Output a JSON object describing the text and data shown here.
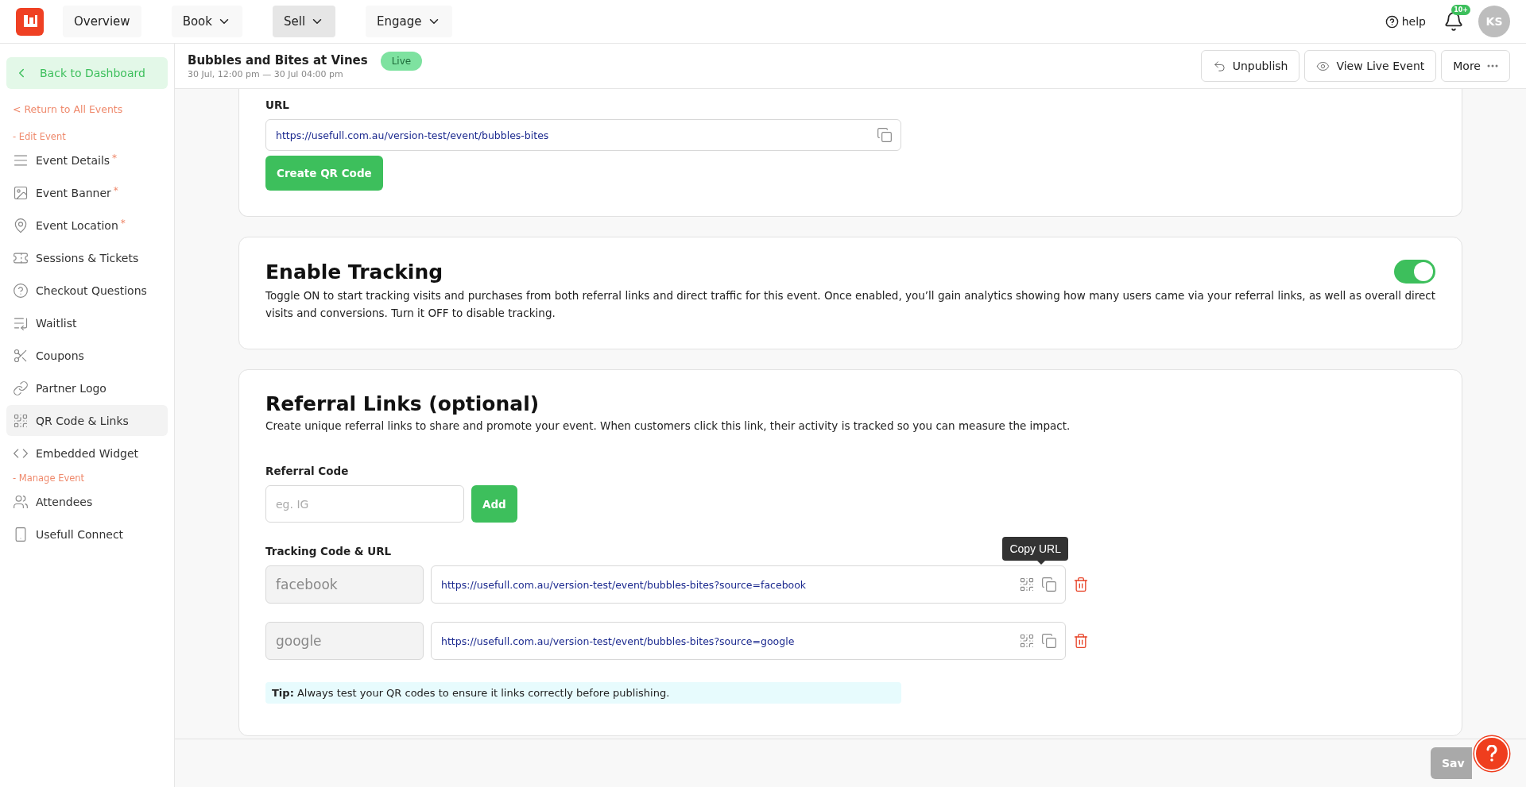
{
  "top_nav": {
    "items": [
      {
        "label": "Overview",
        "dropdown": false,
        "selected": false
      },
      {
        "label": "Book",
        "dropdown": true,
        "selected": false
      },
      {
        "label": "Sell",
        "dropdown": true,
        "selected": true
      },
      {
        "label": "Engage",
        "dropdown": true,
        "selected": false
      }
    ],
    "help": "help",
    "notification_badge": "10+",
    "avatar": "KS"
  },
  "sidebar": {
    "back": "Back to Dashboard",
    "required_mark": "*",
    "return_link": "< Return to All Events",
    "sections": [
      {
        "title": "- Edit Event",
        "items": [
          {
            "label": "Event Details",
            "required": true,
            "selected": false
          },
          {
            "label": "Event Banner",
            "required": true,
            "selected": false
          },
          {
            "label": "Event Location",
            "required": true,
            "selected": false
          },
          {
            "label": "Sessions & Tickets",
            "required": false,
            "selected": false
          },
          {
            "label": "Checkout Questions",
            "required": false,
            "selected": false
          },
          {
            "label": "Waitlist",
            "required": false,
            "selected": false
          },
          {
            "label": "Coupons",
            "required": false,
            "selected": false
          },
          {
            "label": "Partner Logo",
            "required": false,
            "selected": false
          },
          {
            "label": "QR Code & Links",
            "required": false,
            "selected": true
          },
          {
            "label": "Embedded Widget",
            "required": false,
            "selected": false
          }
        ]
      },
      {
        "title": "- Manage Event",
        "items": [
          {
            "label": "Attendees",
            "required": false,
            "selected": false
          },
          {
            "label": "Usefull Connect",
            "required": false,
            "selected": false
          }
        ]
      }
    ]
  },
  "event": {
    "title": "Bubbles and Bites at Vines",
    "dates": "30 Jul, 12:00 pm — 30 Jul 04:00 pm",
    "status": "Live"
  },
  "actions": [
    {
      "label": "Unpublish"
    },
    {
      "label": "View Live Event"
    },
    {
      "label": "More"
    }
  ],
  "url_card": {
    "label": "URL",
    "url": "https://usefull.com.au/version-test/event/bubbles-bites",
    "button": "Create QR Code"
  },
  "tracking": {
    "title": "Enable Tracking",
    "description": "Toggle ON to start tracking visits and purchases from both referral links and direct traffic for this event. Once enabled, you’ll gain analytics showing how many users came via your referral links, as well as overall direct visits and conversions. Turn it OFF to disable tracking.",
    "on": true
  },
  "referral": {
    "title": "Referral Links (optional)",
    "description": "Create unique referral links to share and promote your event. When customers click this link, their activity is tracked so you can measure the impact.",
    "code_label": "Referral Code",
    "code_placeholder": "eg. IG",
    "add": "Add",
    "list_label": "Tracking Code & URL",
    "rows": [
      {
        "code": "facebook",
        "url": "https://usefull.com.au/version-test/event/bubbles-bites?source=facebook",
        "tooltip": "Copy URL"
      },
      {
        "code": "google",
        "url": "https://usefull.com.au/version-test/event/bubbles-bites?source=google"
      }
    ],
    "tip": "**Tip:** Always test your QR codes to ensure it links correctly before publishing."
  },
  "footer": {
    "save": "Sav"
  }
}
